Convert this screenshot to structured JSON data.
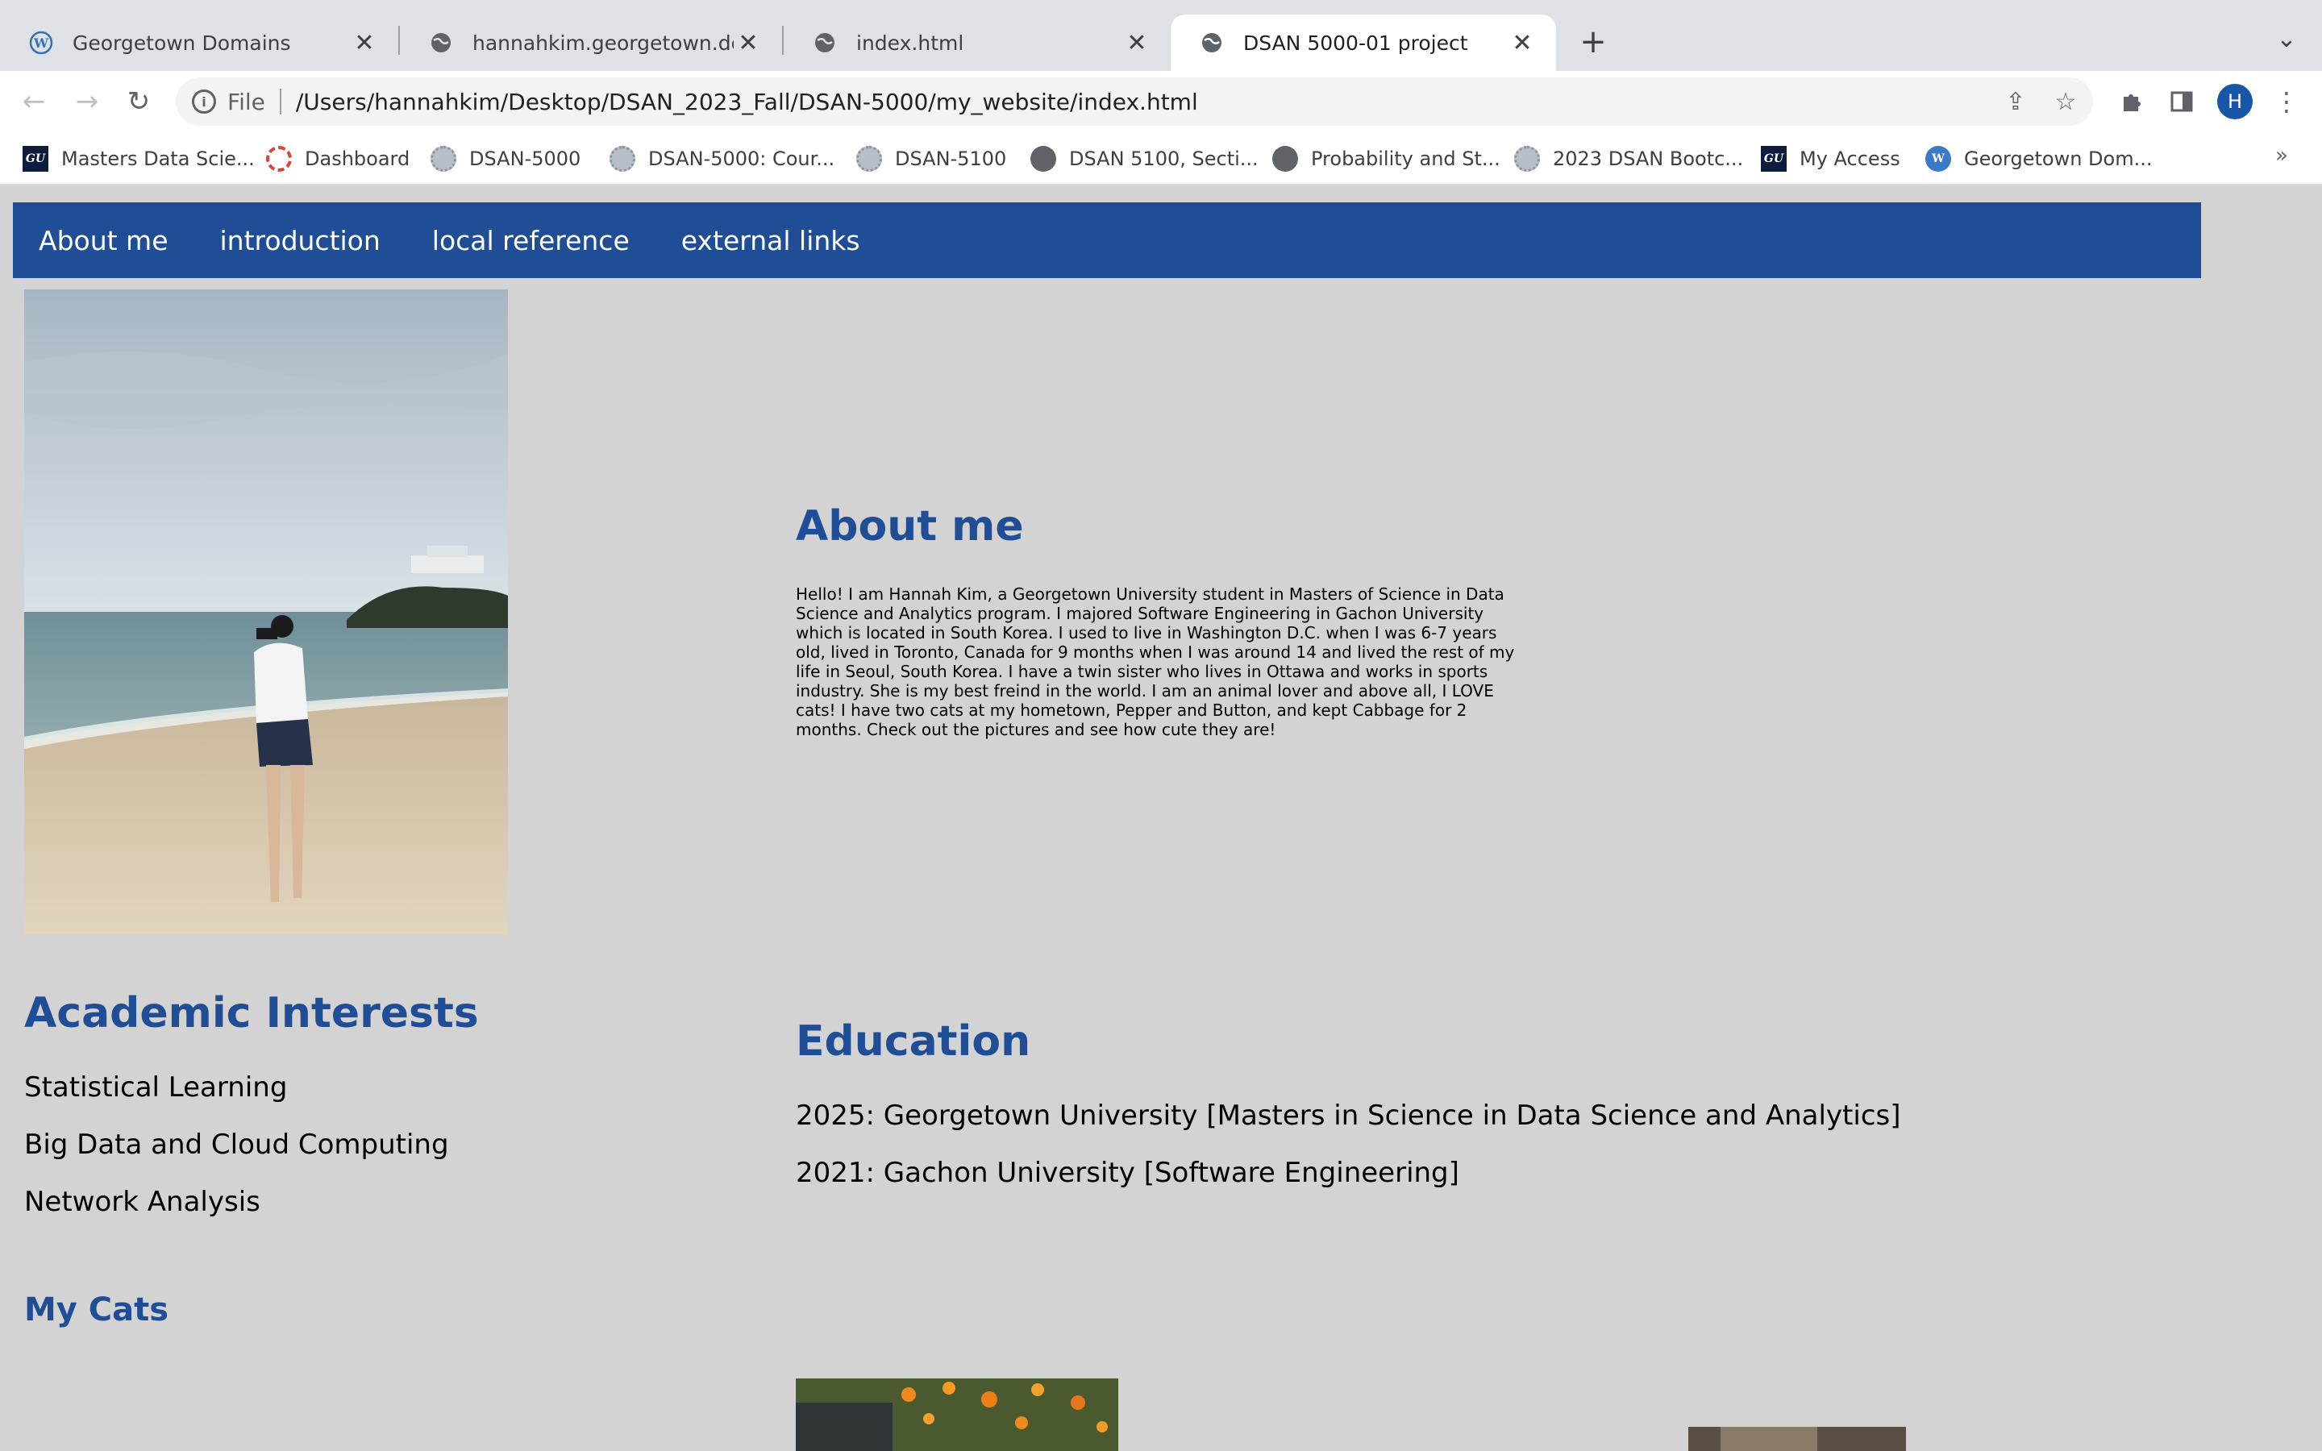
{
  "browser": {
    "tabs": [
      {
        "title": "Georgetown Domains",
        "icon": "wordpress-icon",
        "active": false
      },
      {
        "title": "hannahkim.georgetown.domain",
        "icon": "globe-icon",
        "active": false
      },
      {
        "title": "index.html",
        "icon": "globe-icon",
        "active": false
      },
      {
        "title": "DSAN 5000-01 project",
        "icon": "globe-icon",
        "active": true
      }
    ],
    "address": {
      "scheme_label": "File",
      "url": "/Users/hannahkim/Desktop/DSAN_2023_Fall/DSAN-5000/my_website/index.html"
    },
    "profile_initial": "H",
    "bookmarks": [
      {
        "label": "Masters Data Scie...",
        "icon": "georgetown-gu-icon"
      },
      {
        "label": "Dashboard",
        "icon": "canvas-dashboard-icon"
      },
      {
        "label": "DSAN-5000",
        "icon": "university-seal-icon"
      },
      {
        "label": "DSAN-5000: Cour...",
        "icon": "university-seal-icon"
      },
      {
        "label": "DSAN-5100",
        "icon": "university-seal-icon"
      },
      {
        "label": "DSAN 5100, Secti...",
        "icon": "globe-icon"
      },
      {
        "label": "Probability and St...",
        "icon": "globe-icon"
      },
      {
        "label": "2023 DSAN Bootc...",
        "icon": "university-seal-icon"
      },
      {
        "label": "My Access",
        "icon": "georgetown-gu-icon"
      },
      {
        "label": "Georgetown Dom...",
        "icon": "wordpress-icon"
      }
    ],
    "bookmarks_overflow": "»"
  },
  "site": {
    "nav": [
      "About me",
      "introduction",
      "local reference",
      "external links"
    ],
    "about_heading": "About me",
    "about_text": "Hello! I am Hannah Kim, a Georgetown University student in Masters of Science in Data Science and Analytics program. I majored Software Engineering in Gachon University which is located in South Korea. I used to live in Washington D.C. when I was 6-7 years old, lived in Toronto, Canada for 9 months when I was around 14 and lived the rest of my life in Seoul, South Korea. I have a twin sister who lives in Ottawa and works in sports industry. She is my best freind in the world. I am an animal lover and above all, I LOVE cats! I have two cats at my hometown, Pepper and Button, and kept Cabbage for 2 months. Check out the pictures and see how cute they are!",
    "academic_heading": "Academic Interests",
    "interests": [
      "Statistical Learning",
      "Big Data and Cloud Computing",
      "Network Analysis"
    ],
    "cats_heading": "My Cats",
    "education_heading": "Education",
    "education": [
      "2025: Georgetown University [Masters in Science in Data Science and Analytics]",
      "2021: Gachon University [Software Engineering]"
    ]
  },
  "colors": {
    "accent": "#1f4e96",
    "page_bg": "#d3d3d3",
    "tabstrip_bg": "#dee1e6"
  }
}
